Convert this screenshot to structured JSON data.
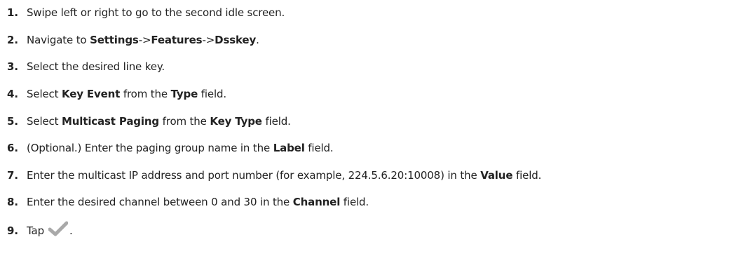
{
  "steps": [
    {
      "number": "1.",
      "parts": [
        {
          "text": "Swipe left or right to go to the second idle screen.",
          "bold": false
        }
      ]
    },
    {
      "number": "2.",
      "parts": [
        {
          "text": "Navigate to ",
          "bold": false
        },
        {
          "text": "Settings",
          "bold": true
        },
        {
          "text": "->",
          "bold": false
        },
        {
          "text": "Features",
          "bold": true
        },
        {
          "text": "->",
          "bold": false
        },
        {
          "text": "Dsskey",
          "bold": true
        },
        {
          "text": ".",
          "bold": false
        }
      ]
    },
    {
      "number": "3.",
      "parts": [
        {
          "text": "Select the desired line key.",
          "bold": false
        }
      ]
    },
    {
      "number": "4.",
      "parts": [
        {
          "text": "Select ",
          "bold": false
        },
        {
          "text": "Key Event",
          "bold": true
        },
        {
          "text": " from the ",
          "bold": false
        },
        {
          "text": "Type",
          "bold": true
        },
        {
          "text": " field.",
          "bold": false
        }
      ]
    },
    {
      "number": "5.",
      "parts": [
        {
          "text": "Select ",
          "bold": false
        },
        {
          "text": "Multicast Paging",
          "bold": true
        },
        {
          "text": " from the ",
          "bold": false
        },
        {
          "text": "Key Type",
          "bold": true
        },
        {
          "text": " field.",
          "bold": false
        }
      ]
    },
    {
      "number": "6.",
      "parts": [
        {
          "text": "(Optional.) Enter the paging group name in the ",
          "bold": false
        },
        {
          "text": "Label",
          "bold": true
        },
        {
          "text": " field.",
          "bold": false
        }
      ]
    },
    {
      "number": "7.",
      "parts": [
        {
          "text": "Enter the multicast IP address and port number (for example, 224.5.6.20:10008) in the ",
          "bold": false
        },
        {
          "text": "Value",
          "bold": true
        },
        {
          "text": " field.",
          "bold": false
        }
      ]
    },
    {
      "number": "8.",
      "parts": [
        {
          "text": "Enter the desired channel between 0 and 30 in the ",
          "bold": false
        },
        {
          "text": "Channel",
          "bold": true
        },
        {
          "text": " field.",
          "bold": false
        }
      ]
    },
    {
      "number": "9.",
      "parts": [
        {
          "text": "Tap",
          "bold": false
        },
        {
          "icon": "check-icon"
        },
        {
          "text": ".",
          "bold": false
        }
      ]
    }
  ],
  "icon_color": "#a9a9a9"
}
